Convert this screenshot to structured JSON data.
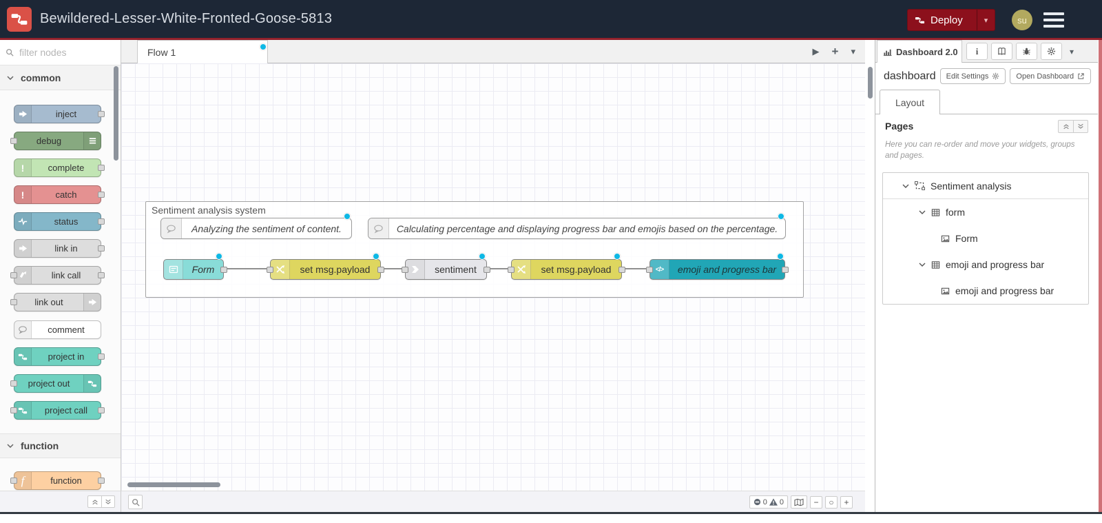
{
  "header": {
    "title": "Bewildered-Lesser-White-Fronted-Goose-5813",
    "deploy_label": "Deploy",
    "avatar_initials": "su"
  },
  "palette": {
    "search_placeholder": "filter nodes",
    "sections": [
      {
        "label": "common",
        "nodes": [
          {
            "label": "inject"
          },
          {
            "label": "debug"
          },
          {
            "label": "complete"
          },
          {
            "label": "catch"
          },
          {
            "label": "status"
          },
          {
            "label": "link in"
          },
          {
            "label": "link call"
          },
          {
            "label": "link out"
          },
          {
            "label": "comment"
          },
          {
            "label": "project in"
          },
          {
            "label": "project out"
          },
          {
            "label": "project call"
          }
        ]
      },
      {
        "label": "function",
        "nodes": [
          {
            "label": "function"
          }
        ]
      }
    ]
  },
  "workspace": {
    "tab_label": "Flow 1",
    "group_label": "Sentiment analysis system",
    "comments": [
      "Analyzing the sentiment of content.",
      "Calculating percentage and displaying progress bar and emojis based on the percentage."
    ],
    "nodes": [
      {
        "label": "Form"
      },
      {
        "label": "set msg.payload"
      },
      {
        "label": "sentiment"
      },
      {
        "label": "set msg.payload"
      },
      {
        "label": "emoji and progress bar"
      }
    ],
    "footer": {
      "error_count": "0",
      "warning_count": "0"
    }
  },
  "sidebar": {
    "active_tab": "Dashboard 2.0",
    "instance_name": "dashboard",
    "edit_settings_label": "Edit Settings",
    "open_dashboard_label": "Open Dashboard",
    "layout_tab_label": "Layout",
    "pages_title": "Pages",
    "pages_help": "Here you can re-order and move your widgets, groups and pages.",
    "tree": {
      "page": "Sentiment analysis",
      "groups": [
        {
          "label": "form",
          "widgets": [
            {
              "label": "Form"
            }
          ]
        },
        {
          "label": "emoji and progress bar",
          "widgets": [
            {
              "label": "emoji and progress bar"
            }
          ]
        }
      ]
    }
  },
  "glyphs": {
    "caret_down": "▾",
    "play": "▶",
    "plus": "+",
    "zoom_out": "−",
    "zoom_reset": "○",
    "zoom_in": "+",
    "code": "</>",
    "function_f": "f",
    "exclamation": "!",
    "info": "i"
  },
  "colors": {
    "header_bg": "#1d2736",
    "header_border": "#93222c",
    "brand_red": "#da5147",
    "deploy_bg": "#8c101c",
    "changed_dot": "#0eb8e5",
    "node_inject": "#a6bbcf",
    "node_debug": "#87a980",
    "node_complete": "#c2e5b4",
    "node_catch": "#e49191",
    "node_status": "#84b7c9",
    "node_link": "#dddddd",
    "node_comment": "#ffffff",
    "node_project": "#6fd1c0",
    "node_function": "#fdd0a2",
    "node_form": "#89dcd8",
    "node_change": "#ded65f",
    "node_sentiment": "#e6e6ea",
    "node_template": "#21a6b6",
    "right_strip": "#cf7278"
  }
}
